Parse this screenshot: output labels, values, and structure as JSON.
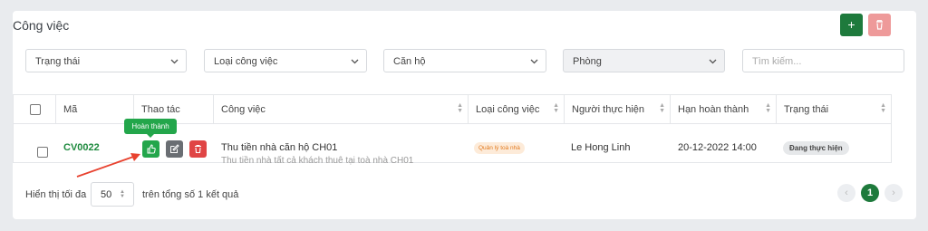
{
  "page": {
    "title": "Công việc"
  },
  "toolbar": {
    "add_label": "+"
  },
  "filters": {
    "status": "Trạng thái",
    "job_type": "Loại công việc",
    "apartment": "Căn hộ",
    "room": "Phòng",
    "search_placeholder": "Tìm kiếm..."
  },
  "table": {
    "headers": [
      "Mã",
      "Thao tác",
      "Công việc",
      "Loại công việc",
      "Người thực hiện",
      "Hạn hoàn thành",
      "Trạng thái"
    ],
    "rows": [
      {
        "code": "CV0022",
        "task": "Thu tiền nhà căn hộ CH01",
        "task_desc": "Thu tiền nhà tất cả khách thuê tại toà nhà CH01",
        "type": "Quản lý toà nhà",
        "assignee": "Le Hong Linh",
        "deadline": "20-12-2022 14:00",
        "status": "Đang thực hiện"
      }
    ]
  },
  "tooltip": {
    "complete": "Hoàn thành"
  },
  "footer": {
    "show_label": "Hiển thị tối đa",
    "page_size": "50",
    "total_label": "trên tổng số 1 kết quả",
    "current_page": "1"
  },
  "colors": {
    "primary": "#1e7a3c",
    "danger": "#e04545",
    "accent_arrow": "#e8422f"
  }
}
